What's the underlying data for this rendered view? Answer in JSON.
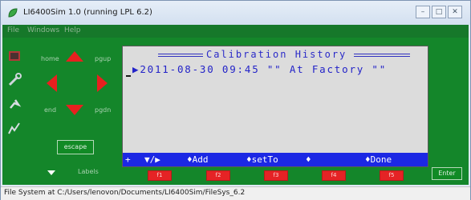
{
  "window": {
    "title": "LI6400Sim 1.0 (running LPL 6.2)"
  },
  "menu": {
    "items": [
      "File",
      "Windows",
      "Help"
    ]
  },
  "nav": {
    "home": "home",
    "pgup": "pgup",
    "end": "end",
    "pgdn": "pgdn"
  },
  "escape_label": "escape",
  "labels_label": "Labels",
  "screen": {
    "title": "Calibration History",
    "row": "▶2011-08-30 09:45 \"\" At Factory \"\"",
    "softkeys": [
      "+",
      "▼/▶",
      "♦Add",
      "♦setTo",
      "♦",
      "♦Done"
    ]
  },
  "fkeys": [
    "f1",
    "f2",
    "f3",
    "f4",
    "f5"
  ],
  "enter_label": "Enter",
  "status": "File System at C:/Users/lenovon/Documents/LI6400Sim/FileSys_6.2",
  "colors": {
    "device_green": "#14862a",
    "arrow_red": "#e8201f",
    "lcd_blue": "#1c28e4",
    "lcd_text": "#2323c8"
  }
}
